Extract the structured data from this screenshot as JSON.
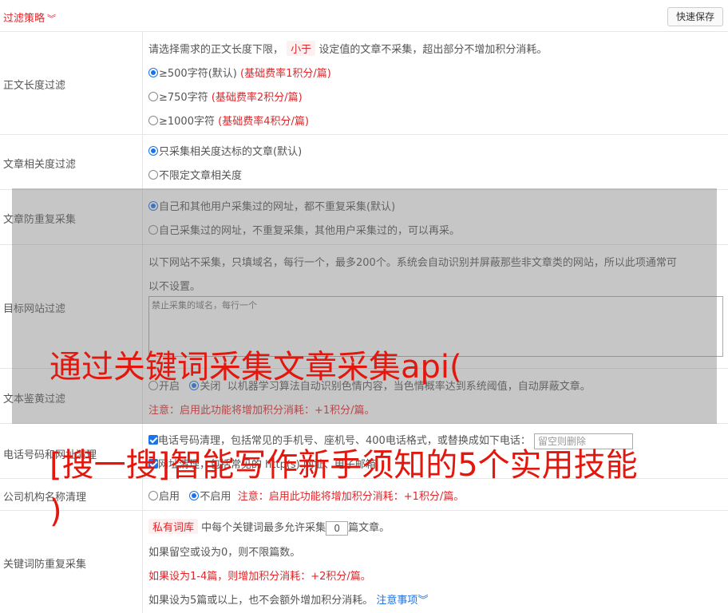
{
  "header": {
    "title": "过滤策略",
    "save_label": "快速保存"
  },
  "length_filter": {
    "label": "正文长度过滤",
    "desc_before": "请选择需求的正文长度下限，",
    "desc_tag": "小于",
    "desc_after": "设定值的文章不采集，超出部分不增加积分消耗。",
    "options": [
      {
        "text": "≥500字符(默认)",
        "note": "(基础费率1积分/篇)",
        "checked": true
      },
      {
        "text": "≥750字符",
        "note": "(基础费率2积分/篇)",
        "checked": false
      },
      {
        "text": "≥1000字符",
        "note": "(基础费率4积分/篇)",
        "checked": false
      }
    ]
  },
  "relevance": {
    "label": "文章相关度过滤",
    "options": [
      {
        "text": "只采集相关度达标的文章(默认)",
        "checked": true
      },
      {
        "text": "不限定文章相关度",
        "checked": false
      }
    ]
  },
  "dedup": {
    "label": "文章防重复采集",
    "options": [
      {
        "text": "自己和其他用户采集过的网址，都不重复采集(默认)",
        "checked": true
      },
      {
        "text": "自己采集过的网址，不重复采集，其他用户采集过的，可以再采。",
        "checked": false
      }
    ]
  },
  "site_filter": {
    "label": "目标网站过滤",
    "desc_line1": "以下网站不采集，只填域名，每行一个，最多200个。系统会自动识别并屏蔽那些非文章类的网站，所以此项通常可",
    "desc_line2": "以不设置。",
    "placeholder": "禁止采集的域名，每行一个"
  },
  "porn_filter": {
    "label": "文本鉴黄过滤",
    "on_label": "开启",
    "off_label": "关闭",
    "desc": "以机器学习算法自动识别色情内容，当色情概率达到系统阈值，自动屏蔽文章。",
    "note": "注意：启用此功能将增加积分消耗：+1积分/篇。"
  },
  "phone_clean": {
    "label": "电话号码和网址清理",
    "desc": "电话号码清理，包括常见的手机号、座机号、400电话格式，或替换成如下电话：",
    "input_placeholder": "留空则删除",
    "line2": "网址清理，包括常见的 http(s) 网址、电子邮箱"
  },
  "org_clean": {
    "label": "公司机构名称清理",
    "on_label": "启用",
    "off_label": "不启用",
    "note": "注意：启用此功能将增加积分消耗：+1积分/篇。"
  },
  "keyword_dedup": {
    "label": "关键词防重复采集",
    "tag": "私有词库",
    "line1_before": "中每个关键词最多允许采集",
    "line1_value": "0",
    "line1_after": "篇文章。",
    "line2": "如果留空或设为0，则不限篇数。",
    "line3": "如果设为1-4篇，则增加积分消耗：+2积分/篇。",
    "line4": "如果设为5篇或以上，也不会额外增加积分消耗。",
    "link": "注意事项"
  },
  "overlay_title": {
    "line1": "通过关键词采集文章采集api(",
    "line2": "[搜一搜]智能写作新手须知的5个实用技能",
    "line3": ")"
  }
}
